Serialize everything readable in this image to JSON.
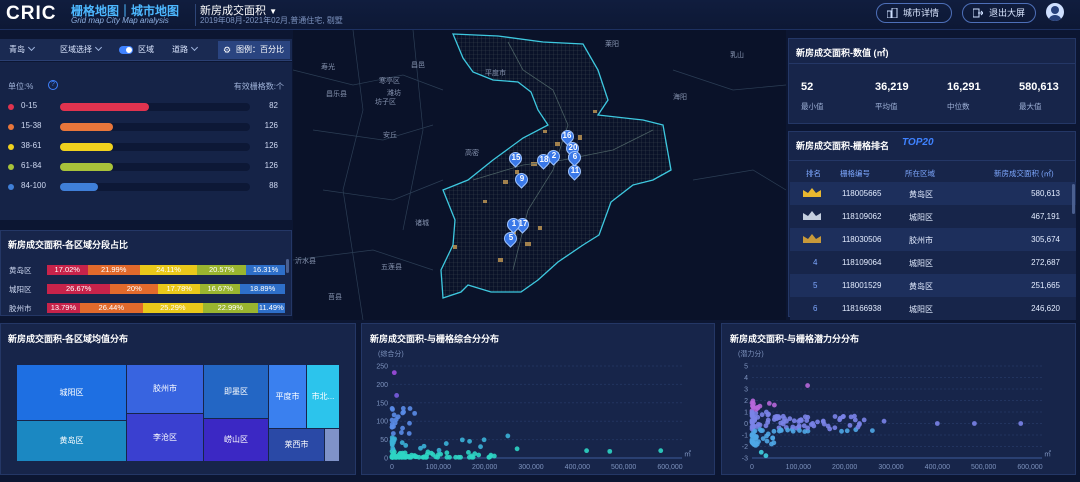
{
  "header": {
    "logo": "CRIC",
    "brand_cn": "栅格地图｜城市地图",
    "brand_en": "Grid  map City Map analysis",
    "page_title": "新房成交面积",
    "page_subtitle": "2019年08月-2021年02月,普通住宅, 剔墅",
    "btn_city_detail": "城市详情",
    "btn_exit_fullscreen": "退出大屏"
  },
  "filters": {
    "city": "青岛",
    "region_select": "区域选择",
    "region_toggle_label": "区域",
    "road": "道路",
    "legend_btn": "图例：百分比"
  },
  "legend": {
    "unit": "单位:%",
    "right_label": "有效栅格数:个",
    "items": [
      {
        "range": "0-15",
        "count": "82",
        "color": "#e0334f",
        "fill": 0.47
      },
      {
        "range": "15-38",
        "count": "126",
        "color": "#e8763b",
        "fill": 0.28
      },
      {
        "range": "38-61",
        "count": "126",
        "color": "#f0d21e",
        "fill": 0.28
      },
      {
        "range": "61-84",
        "count": "126",
        "color": "#a8c23a",
        "fill": 0.28
      },
      {
        "range": "84-100",
        "count": "88",
        "color": "#3f7fd8",
        "fill": 0.2
      }
    ]
  },
  "dist_panel": {
    "title_a": "新房成交面积",
    "title_b": "-各区域分段占比",
    "rows": [
      {
        "name": "黄岛区",
        "segs": [
          "17.02%",
          "21.99%",
          "24.11%",
          "20.57%",
          "16.31%"
        ],
        "w": [
          17.02,
          21.99,
          24.11,
          20.57,
          16.31
        ]
      },
      {
        "name": "城阳区",
        "segs": [
          "26.67%",
          "20%",
          "17.78%",
          "16.67%",
          "18.89%"
        ],
        "w": [
          26.67,
          20,
          17.78,
          16.67,
          18.89
        ]
      },
      {
        "name": "胶州市",
        "segs": [
          "13.79%",
          "26.44%",
          "25.29%",
          "22.99%",
          "11.49%"
        ],
        "w": [
          13.79,
          26.44,
          25.29,
          22.99,
          11.49
        ]
      }
    ]
  },
  "map": {
    "labels": [
      "寿光",
      "昌邑",
      "平度市",
      "莱阳",
      "乳山",
      "寒亭区",
      "潍坊",
      "坊子区",
      "昌乐县",
      "海阳",
      "安丘",
      "高密",
      "诸城",
      "五莲县",
      "沂水县",
      "莒县"
    ],
    "pins": [
      "16",
      "20",
      "2",
      "18",
      "15",
      "6",
      "11",
      "9",
      "17",
      "5",
      "1"
    ]
  },
  "stats": {
    "title_a": "新房成交面积",
    "title_b": "-数值 (㎡)",
    "items": [
      {
        "v": "52",
        "l": "最小值"
      },
      {
        "v": "36,219",
        "l": "平均值"
      },
      {
        "v": "16,291",
        "l": "中位数"
      },
      {
        "v": "580,613",
        "l": "最大值"
      }
    ]
  },
  "rank": {
    "title_a": "新房成交面积",
    "title_b": "-栅格排名",
    "badge": "TOP20",
    "cols": [
      "排名",
      "栅格编号",
      "所在区域",
      "新房成交面积 (㎡)"
    ],
    "rows": [
      {
        "rank": "",
        "id": "118005665",
        "area": "黄岛区",
        "val": "580,613",
        "crown": "gold"
      },
      {
        "rank": "",
        "id": "118109062",
        "area": "城阳区",
        "val": "467,191",
        "crown": "silver"
      },
      {
        "rank": "",
        "id": "118030506",
        "area": "胶州市",
        "val": "305,674",
        "crown": "bronze"
      },
      {
        "rank": "4",
        "id": "118109064",
        "area": "城阳区",
        "val": "272,687",
        "crown": ""
      },
      {
        "rank": "5",
        "id": "118001529",
        "area": "黄岛区",
        "val": "251,665",
        "crown": ""
      },
      {
        "rank": "6",
        "id": "118166938",
        "area": "城阳区",
        "val": "246,620",
        "crown": ""
      }
    ]
  },
  "treemap": {
    "title_a": "新房成交面积",
    "title_b": "-各区域均值分布",
    "cells": [
      "城阳区",
      "黄岛区",
      "胶州市",
      "李沧区",
      "即墨区",
      "崂山区",
      "平度市",
      "市北...",
      "莱西市"
    ]
  },
  "scatter1": {
    "title_a": "新房成交面积",
    "title_b": "-与栅格综合分分布",
    "ylabel": "(综合分)",
    "yticks": [
      "250",
      "200",
      "150",
      "100",
      "50",
      "0"
    ],
    "xticks": [
      "0",
      "100,000",
      "200,000",
      "300,000",
      "400,000",
      "500,000",
      "600,000"
    ],
    "xunit": "㎡"
  },
  "scatter2": {
    "title_a": "新房成交面积",
    "title_b": "-与栅格潜力分分布",
    "ylabel": "(潜力分)",
    "yticks": [
      "5",
      "4",
      "3",
      "2",
      "1",
      "0",
      "-1",
      "-2",
      "-3"
    ],
    "xticks": [
      "0",
      "100,000",
      "200,000",
      "300,000",
      "400,000",
      "500,000",
      "600,000"
    ],
    "xunit": "㎡"
  }
}
